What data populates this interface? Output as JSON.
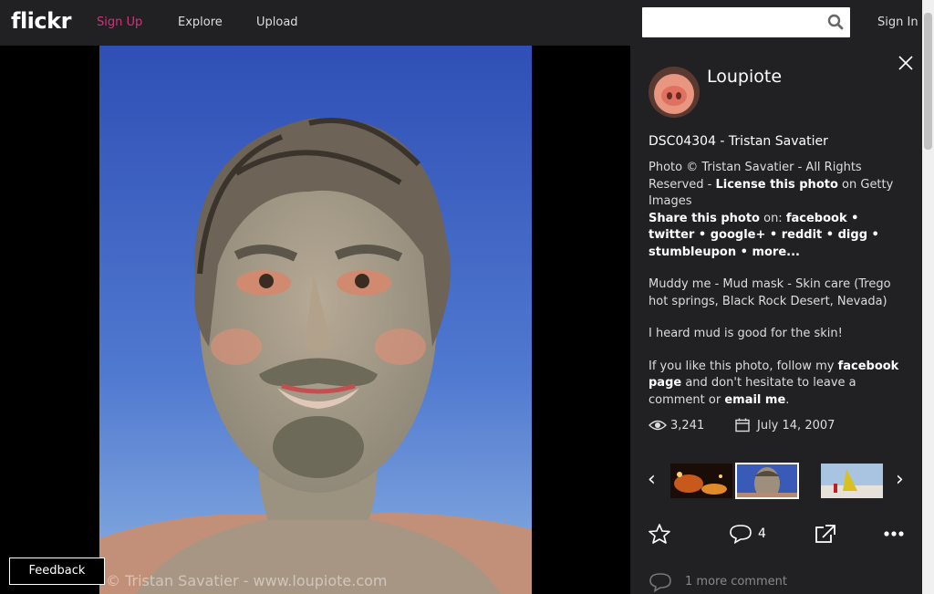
{
  "header": {
    "logo": "flickr",
    "nav": {
      "signup": "Sign Up",
      "explore": "Explore",
      "upload": "Upload"
    },
    "search": {
      "value": "",
      "placeholder": ""
    },
    "signin": "Sign In"
  },
  "photo": {
    "watermark": "© Tristan Savatier - www.loupiote.com"
  },
  "feedback_label": "Feedback",
  "panel": {
    "username": "Loupiote",
    "title": "DSC04304 - Tristan Savatier",
    "desc1_a": "Photo © Tristan Savatier - All Rights Reserved - ",
    "license_link": "License this photo",
    "desc1_b": " on Getty Images",
    "share_label": "Share this photo",
    "share_on": " on: ",
    "share_links": [
      "facebook",
      "twitter",
      "google+",
      "reddit",
      "digg",
      "stumbleupon",
      "more..."
    ],
    "desc2": "Muddy me - Mud mask - Skin care (Trego hot springs, Black Rock Desert, Nevada)",
    "desc3": "I heard mud is good for the skin!",
    "desc4_a": "If you like this photo, follow my ",
    "facebook_page": "facebook page",
    "desc4_b": " and don't hesitate to leave a comment or ",
    "email_me": "email me",
    "desc4_c": ".",
    "views": "3,241",
    "date": "July 14, 2007",
    "faves_count": "4",
    "more_comments": "1 more comment"
  },
  "icons": {
    "search": "search-icon",
    "close": "close-icon",
    "views": "eye-icon",
    "date": "calendar-icon",
    "fave": "star-icon",
    "comment": "comment-icon",
    "share": "share-icon",
    "more": "more-icon"
  },
  "colors": {
    "brand_pink": "#d4317c",
    "topbar": "#212124",
    "panel": "#212124"
  }
}
